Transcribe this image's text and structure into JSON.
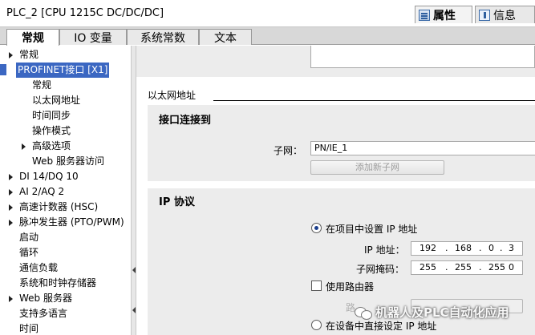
{
  "window": {
    "title": "PLC_2 [CPU 1215C DC/DC/DC]"
  },
  "inspector_tabs": [
    {
      "label": "属性",
      "icon": "properties-icon",
      "active": true
    },
    {
      "label": "信息",
      "icon": "info-icon",
      "active": false
    }
  ],
  "tabs": [
    {
      "label": "常规",
      "active": true
    },
    {
      "label": "IO 变量",
      "active": false
    },
    {
      "label": "系统常数",
      "active": false
    },
    {
      "label": "文本",
      "active": false
    }
  ],
  "nav": {
    "items": [
      {
        "label": "常规",
        "level": 0,
        "arrow": "right"
      },
      {
        "label": "PROFINET接口 [X1]",
        "level": 0,
        "arrow": "down",
        "selected": true
      },
      {
        "label": "常规",
        "level": 1,
        "arrow": ""
      },
      {
        "label": "以太网地址",
        "level": 1,
        "arrow": ""
      },
      {
        "label": "时间同步",
        "level": 1,
        "arrow": ""
      },
      {
        "label": "操作模式",
        "level": 1,
        "arrow": ""
      },
      {
        "label": "高级选项",
        "level": 1,
        "arrow": "right"
      },
      {
        "label": "Web 服务器访问",
        "level": 1,
        "arrow": ""
      },
      {
        "label": "DI 14/DQ 10",
        "level": 0,
        "arrow": "right"
      },
      {
        "label": "AI 2/AQ 2",
        "level": 0,
        "arrow": "right"
      },
      {
        "label": "高速计数器 (HSC)",
        "level": 0,
        "arrow": "right"
      },
      {
        "label": "脉冲发生器 (PTO/PWM)",
        "level": 0,
        "arrow": "right"
      },
      {
        "label": "启动",
        "level": 0,
        "arrow": ""
      },
      {
        "label": "循环",
        "level": 0,
        "arrow": ""
      },
      {
        "label": "通信负载",
        "level": 0,
        "arrow": ""
      },
      {
        "label": "系统和时钟存储器",
        "level": 0,
        "arrow": ""
      },
      {
        "label": "Web 服务器",
        "level": 0,
        "arrow": "right"
      },
      {
        "label": "支持多语言",
        "level": 0,
        "arrow": ""
      },
      {
        "label": "时间",
        "level": 0,
        "arrow": ""
      }
    ]
  },
  "main": {
    "ethernet_section_title": "以太网地址",
    "interface": {
      "title": "接口连接到",
      "subnet_label": "子网：",
      "subnet_value": "PN/IE_1",
      "add_subnet_button": "添加新子网"
    },
    "ip": {
      "title": "IP 协议",
      "option_project": "在项目中设置 IP 地址",
      "ip_label": "IP 地址：",
      "ip_parts": [
        "192",
        "168",
        "0",
        "3"
      ],
      "mask_label": "子网掩码：",
      "mask_parts": [
        "255",
        "255",
        "255",
        "0"
      ],
      "use_router_label": "使用路由器",
      "router_label_partial": "路",
      "option_device": "在设备中直接设定 IP 地址"
    }
  },
  "watermark": "机器人及PLC自动化应用",
  "colors": {
    "selection": "#3b67c2",
    "panel": "#ececec",
    "radio_dot": "#1b3e8c"
  }
}
